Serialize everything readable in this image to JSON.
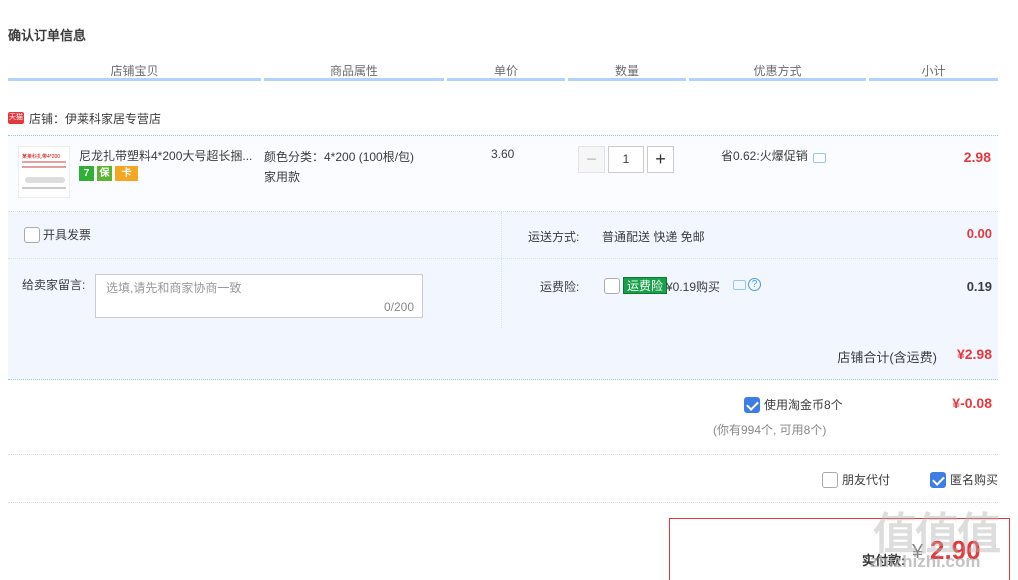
{
  "page": {
    "title": "确认订单信息"
  },
  "table_headers": [
    "店铺宝贝",
    "商品属性",
    "单价",
    "数量",
    "优惠方式",
    "小计"
  ],
  "shop": {
    "icon": "tmall-icon",
    "icon_text": "天猫",
    "label": "店铺：伊莱科家居专营店"
  },
  "item": {
    "thumb_text": "某莱科扎带4*200",
    "title": "尼龙扎带塑料4*200大号超长捆...",
    "badges": [
      "7",
      "保",
      "卡"
    ],
    "attr_line1": "颜色分类：4*200 (100根/包)",
    "attr_line2": "家用款",
    "price": "3.60",
    "quantity": "1",
    "minus": "−",
    "plus": "+",
    "promo": "省0.62:火爆促销",
    "subtotal": "2.98"
  },
  "options": {
    "invoice_label": "开具发票",
    "shipping_label": "运送方式:",
    "shipping_value": "普通配送 快递 免邮",
    "shipping_cost": "0.00",
    "note_label": "给卖家留言:",
    "note_placeholder": "选填,请先和商家协商一致",
    "note_count": "0/200",
    "insurance_label": "运费险:",
    "insurance_tag": "运费险",
    "insurance_price": "¥0.19购买",
    "insurance_help": "?",
    "insurance_cost": "0.19"
  },
  "shop_total": {
    "label": "店铺合计(含运费)",
    "amount": "¥2.98"
  },
  "coins": {
    "label": "使用淘金币8个",
    "amount": "¥-0.08",
    "sub": "(你有994个, 可用8个)"
  },
  "extra": {
    "friend_pay": "朋友代付",
    "anonymous": "匿名购买"
  },
  "pay": {
    "label": "实付款:",
    "currency": "¥",
    "amount": "2.90"
  },
  "watermark": {
    "main": "值值值",
    "sub": "zhizhizhi.com"
  },
  "colors": {
    "accent": "#e4393c",
    "header_line": "#b2d1ff",
    "panel_bg": "#f2f7ff",
    "checkbox_on": "#3e7ce6"
  }
}
